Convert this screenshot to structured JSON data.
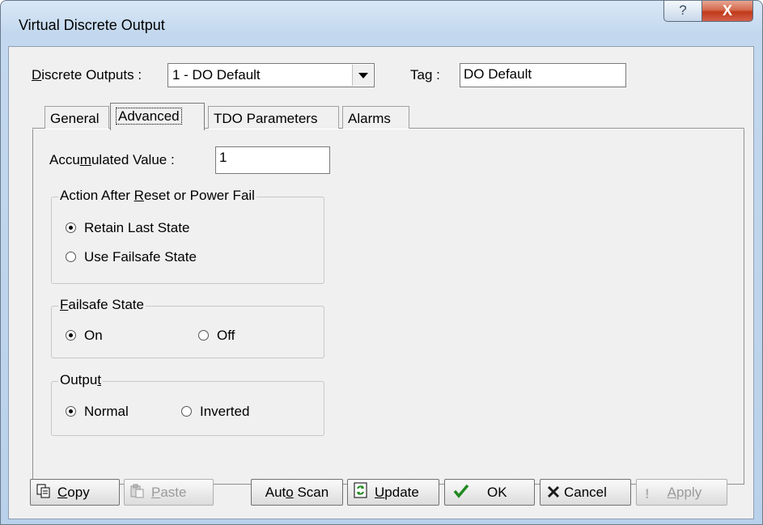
{
  "window": {
    "title": "Virtual Discrete Output",
    "help_glyph": "?",
    "close_glyph": "X"
  },
  "header": {
    "discrete_outputs_label_pre": "D",
    "discrete_outputs_label_post": "iscrete Outputs :",
    "discrete_outputs_value": "1 - DO Default",
    "tag_label": "Tag :",
    "tag_value": "DO Default"
  },
  "tabs": [
    {
      "label": "General"
    },
    {
      "label": "Advanced",
      "active": true
    },
    {
      "label": "TDO Parameters"
    },
    {
      "label": "Alarms"
    }
  ],
  "advanced": {
    "accumulated_label_pre": "Accu",
    "accumulated_label_u": "m",
    "accumulated_label_post": "ulated Value :",
    "accumulated_value": "1",
    "reset_group_pre": "Action After ",
    "reset_group_u": "R",
    "reset_group_post": "eset or Power Fail",
    "retain_label": "Retain Last State",
    "failsafe_label": "Use Failsafe State",
    "failsafe_group_u": "F",
    "failsafe_group_post": "ailsafe State",
    "on_label": "On",
    "off_label": "Off",
    "output_group_pre": "Outpu",
    "output_group_u": "t",
    "normal_label": "Normal",
    "inverted_label": "Inverted"
  },
  "buttons": {
    "copy_u": "C",
    "copy_post": "opy",
    "paste_u": "P",
    "paste_post": "aste",
    "autoscan_pre": "Aut",
    "autoscan_u": "o",
    "autoscan_post": " Scan",
    "update_u": "U",
    "update_post": "pdate",
    "ok": "OK",
    "cancel": "Cancel",
    "apply_u": "A",
    "apply_post": "pply"
  },
  "colors": {
    "ok_check": "#1f8a1f",
    "cancel_x": "#1a1a1a",
    "close_button": "#c0391a"
  }
}
